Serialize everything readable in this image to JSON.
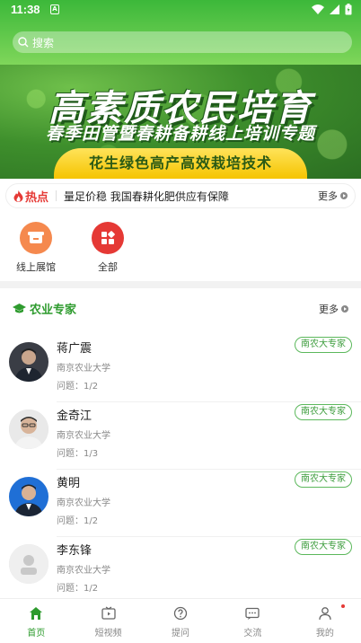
{
  "status": {
    "time": "11:38",
    "sim_label": "A"
  },
  "search": {
    "placeholder": "搜索"
  },
  "banner": {
    "title": "高素质农民培育",
    "subtitle": "春季田管暨春耕备耕线上培训专题",
    "ribbon": "花生绿色高产高效栽培技术"
  },
  "hot": {
    "tag": "热点",
    "news": "量足价稳 我国春耕化肥供应有保障",
    "more": "更多"
  },
  "quick": [
    {
      "label": "线上展馆",
      "icon": "store-icon",
      "color": "#f5894e"
    },
    {
      "label": "全部",
      "icon": "grid-icon",
      "color": "#e53935"
    }
  ],
  "experts_section": {
    "title": "农业专家",
    "more": "更多",
    "items": [
      {
        "name": "蒋广震",
        "org": "南京农业大学",
        "questions": "问题：1/2",
        "badge": "南农大专家"
      },
      {
        "name": "金奇江",
        "org": "南京农业大学",
        "questions": "问题：1/3",
        "badge": "南农大专家"
      },
      {
        "name": "黄明",
        "org": "南京农业大学",
        "questions": "问题：1/2",
        "badge": "南农大专家"
      },
      {
        "name": "李东锋",
        "org": "南京农业大学",
        "questions": "问题：1/2",
        "badge": "南农大专家"
      }
    ]
  },
  "tabs": [
    {
      "label": "首页",
      "icon": "home-icon",
      "active": true
    },
    {
      "label": "短视频",
      "icon": "video-icon",
      "active": false
    },
    {
      "label": "提问",
      "icon": "question-icon",
      "active": false
    },
    {
      "label": "交流",
      "icon": "chat-icon",
      "active": false
    },
    {
      "label": "我的",
      "icon": "user-icon",
      "active": false
    }
  ],
  "colors": {
    "brand_green": "#2e9b2e",
    "hot_red": "#e53935"
  }
}
